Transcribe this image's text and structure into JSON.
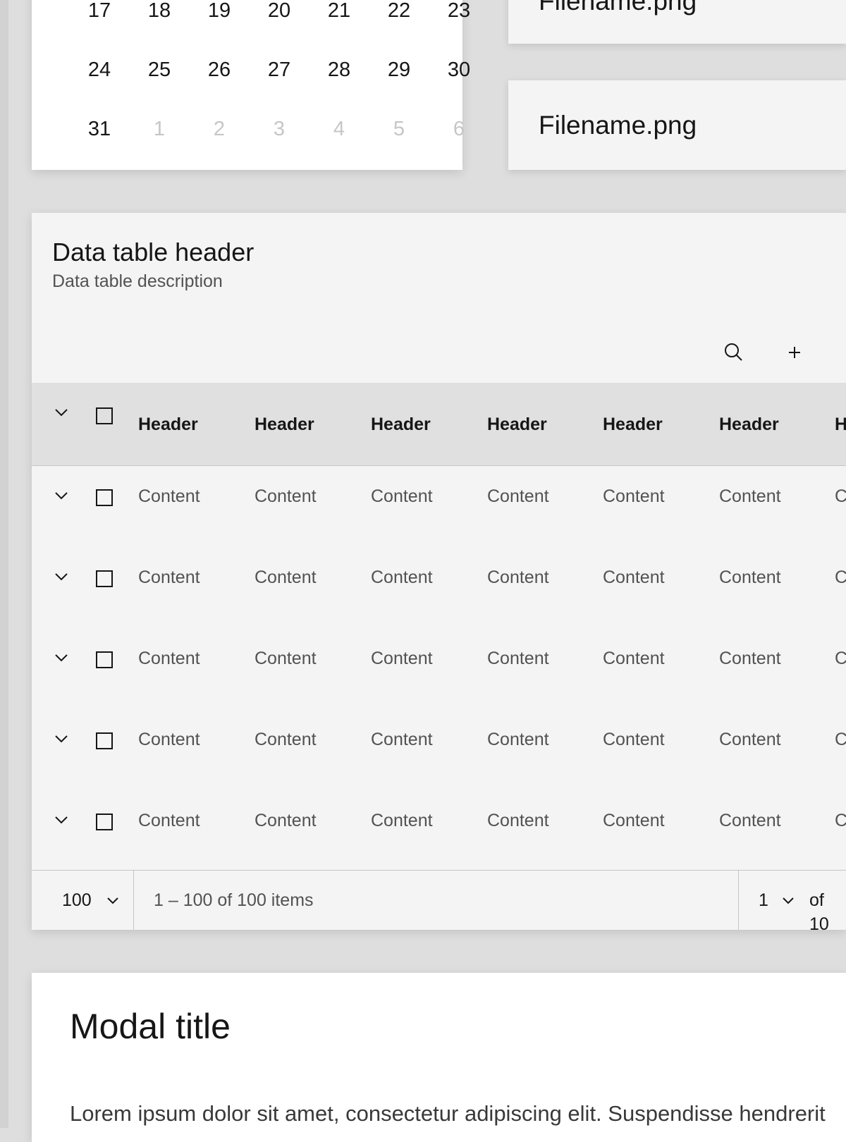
{
  "calendar": {
    "weeks": [
      [
        "17",
        "18",
        "19",
        "20",
        "21",
        "22",
        "23"
      ],
      [
        "24",
        "25",
        "26",
        "27",
        "28",
        "29",
        "30"
      ],
      [
        "31",
        "1",
        "2",
        "3",
        "4",
        "5",
        "6"
      ]
    ]
  },
  "files": [
    {
      "name": "Filename.png"
    },
    {
      "name": "Filename.png"
    }
  ],
  "table": {
    "title": "Data table header",
    "description": "Data table description",
    "toolbar": {
      "search_icon": "search-icon",
      "add_icon": "add-icon"
    },
    "headers": [
      "Header",
      "Header",
      "Header",
      "Header",
      "Header",
      "Header",
      "Header"
    ],
    "rows": [
      [
        "Content",
        "Content",
        "Content",
        "Content",
        "Content",
        "Content",
        "Content"
      ],
      [
        "Content",
        "Content",
        "Content",
        "Content",
        "Content",
        "Content",
        "Content"
      ],
      [
        "Content",
        "Content",
        "Content",
        "Content",
        "Content",
        "Content",
        "Content"
      ],
      [
        "Content",
        "Content",
        "Content",
        "Content",
        "Content",
        "Content",
        "Content"
      ],
      [
        "Content",
        "Content",
        "Content",
        "Content",
        "Content",
        "Content",
        "Content"
      ]
    ],
    "pagination": {
      "page_size": "100",
      "range": "1 – 100 of 100 items",
      "page": "1",
      "of_pages": "of 10"
    }
  },
  "modal": {
    "title": "Modal title",
    "body": "Lorem ipsum dolor sit amet, consectetur adipiscing elit. Suspendisse hendrerit"
  }
}
